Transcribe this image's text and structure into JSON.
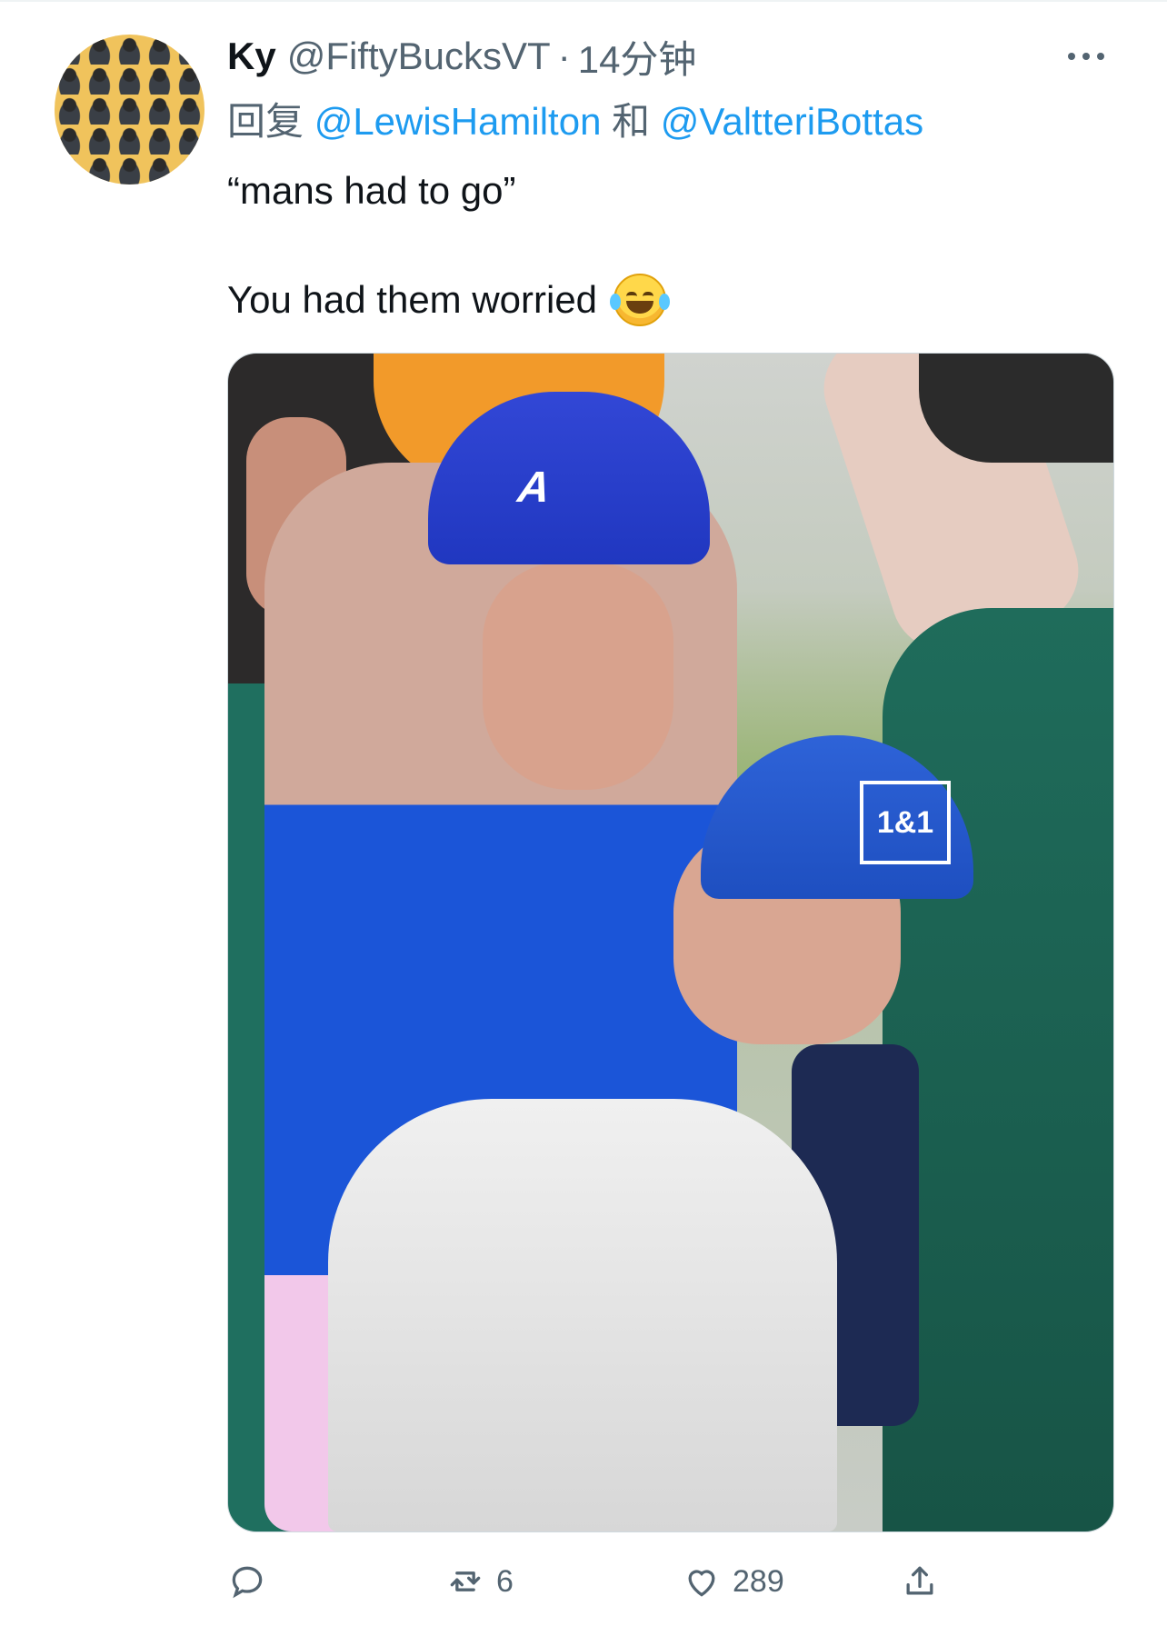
{
  "tweet": {
    "author_name": "Ky",
    "handle": "@FiftyBucksVT",
    "separator": "·",
    "time": "14分钟",
    "reply_prefix": "回复",
    "reply_user_1": "@LewisHamilton",
    "reply_joiner": "和",
    "reply_user_2": "@ValtteriBottas",
    "text_line_1": "“mans had to go”",
    "text_line_2": "You had them worried",
    "emoji_name": "face-with-tears-of-joy"
  },
  "media": {
    "cap_logo_text": "A",
    "badge_text": "1&1"
  },
  "actions": {
    "reply_count": "",
    "retweet_count": "6",
    "like_count": "289",
    "share_count": ""
  },
  "colors": {
    "text_primary": "#0f1419",
    "text_secondary": "#536471",
    "link_blue": "#1d9bf0"
  }
}
